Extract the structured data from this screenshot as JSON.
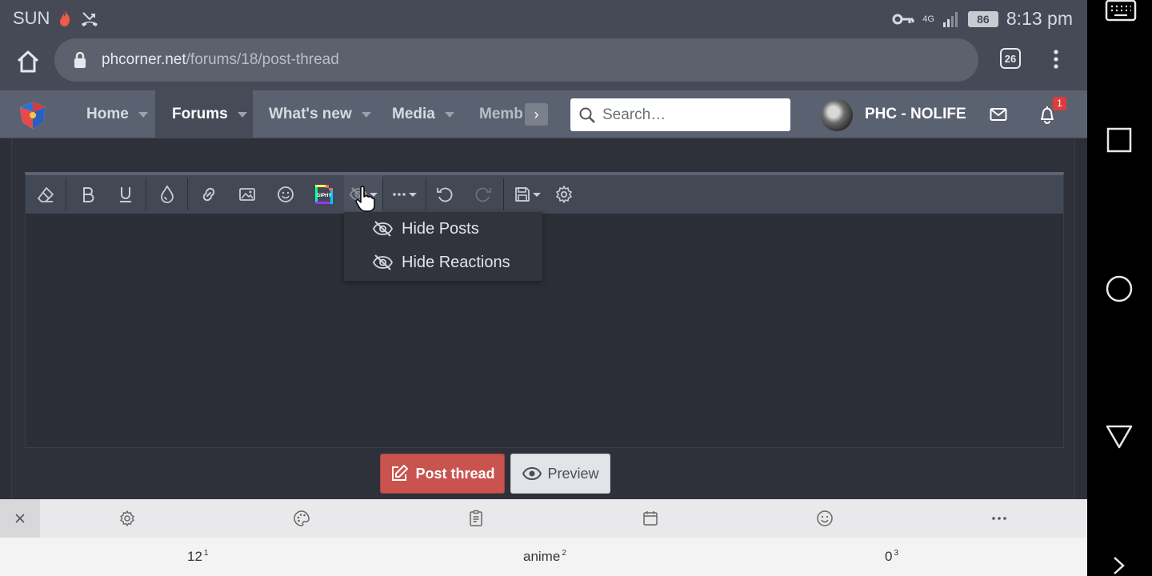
{
  "status": {
    "carrier": "SUN",
    "network": "4G",
    "battery": "86",
    "time": "8:13 pm"
  },
  "browser": {
    "url_host": "phcorner.net",
    "url_path": "/forums/18/post-thread",
    "tab_count": "26"
  },
  "nav": {
    "items": [
      {
        "label": "Home"
      },
      {
        "label": "Forums"
      },
      {
        "label": "What's new"
      },
      {
        "label": "Media"
      },
      {
        "label": "Memb"
      }
    ],
    "more": "›",
    "search_placeholder": "Search…",
    "username": "PHC - NOLIFE",
    "notification_count": "1"
  },
  "editor": {
    "toolbar_icons": [
      "eraser-icon",
      "bold-icon",
      "underline-icon",
      "color-drop-icon",
      "link-icon",
      "image-icon",
      "smiley-icon",
      "giphy-icon",
      "hide-icon",
      "more-options-icon",
      "undo-icon",
      "redo-icon",
      "drafts-icon",
      "settings-icon"
    ],
    "giphy_label": "GIPHY",
    "hide_menu": [
      {
        "label": "Hide Posts"
      },
      {
        "label": "Hide Reactions"
      }
    ]
  },
  "actions": {
    "post_thread": "Post thread",
    "preview": "Preview"
  },
  "keyboard": {
    "suggestions": [
      {
        "word": "12",
        "index": "1"
      },
      {
        "word": "anime",
        "index": "2"
      },
      {
        "word": "0",
        "index": "3"
      }
    ]
  },
  "colors": {
    "accent_red": "#c9534f",
    "nav_bg": "#5a6170",
    "badge": "#e03b3b"
  }
}
